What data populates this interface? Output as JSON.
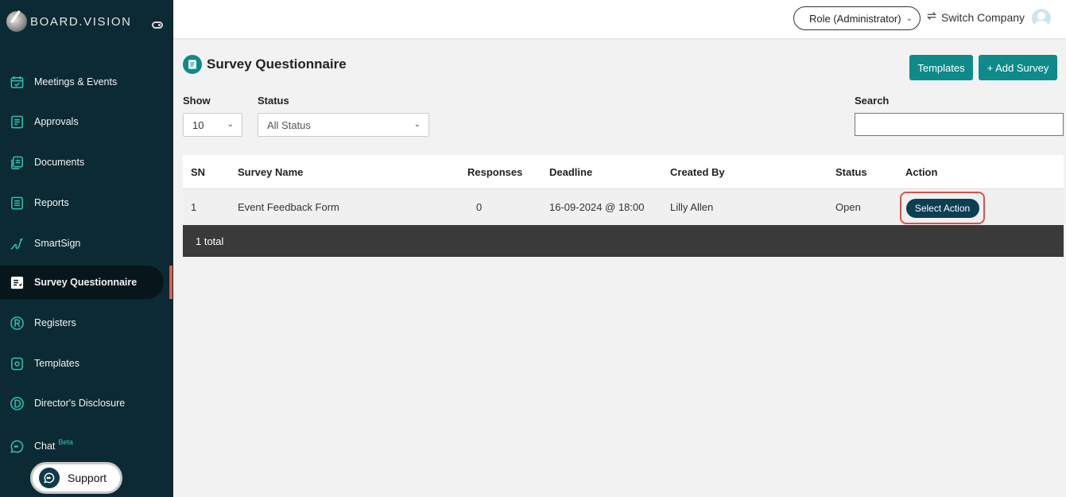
{
  "sidebar": {
    "brand": "BOARD.VISION",
    "items": [
      {
        "label": "Meetings & Events",
        "icon": "calendar-check-icon"
      },
      {
        "label": "Approvals",
        "icon": "approval-doc-icon"
      },
      {
        "label": "Documents",
        "icon": "documents-icon"
      },
      {
        "label": "Reports",
        "icon": "report-icon"
      },
      {
        "label": "SmartSign",
        "icon": "signature-icon"
      },
      {
        "label": "Survey Questionnaire",
        "icon": "survey-icon",
        "active": true
      },
      {
        "label": "Registers",
        "icon": "registered-icon"
      },
      {
        "label": "Templates",
        "icon": "template-icon"
      },
      {
        "label": "Director's Disclosure",
        "icon": "disclosure-icon"
      },
      {
        "label": "Chat",
        "icon": "chat-icon",
        "badge": "Beta"
      }
    ],
    "support_label": "Support"
  },
  "topbar": {
    "role": "Role (Administrator)",
    "switch_company": "Switch Company"
  },
  "page": {
    "title": "Survey Questionnaire",
    "templates_button": "Templates",
    "add_button": "+ Add Survey",
    "show_label": "Show",
    "show_value": "10",
    "status_label": "Status",
    "status_value": "All Status",
    "search_label": "Search",
    "search_value": ""
  },
  "table": {
    "headers": [
      "SN",
      "Survey Name",
      "Responses",
      "Deadline",
      "Created By",
      "Status",
      "Action"
    ],
    "rows": [
      {
        "sn": "1",
        "name": "Event Feedback Form",
        "responses": "0",
        "deadline": "16-09-2024 @ 18:00",
        "created_by": "Lilly Allen",
        "status": "Open",
        "action": "Select Action"
      }
    ],
    "footer": "1 total"
  },
  "colors": {
    "sidebar_bg": "#0c2a33",
    "accent_teal": "#0e8a8a",
    "action_button": "#0d3f52",
    "highlight": "#d9534a",
    "active_indicator": "#e05a4e"
  }
}
